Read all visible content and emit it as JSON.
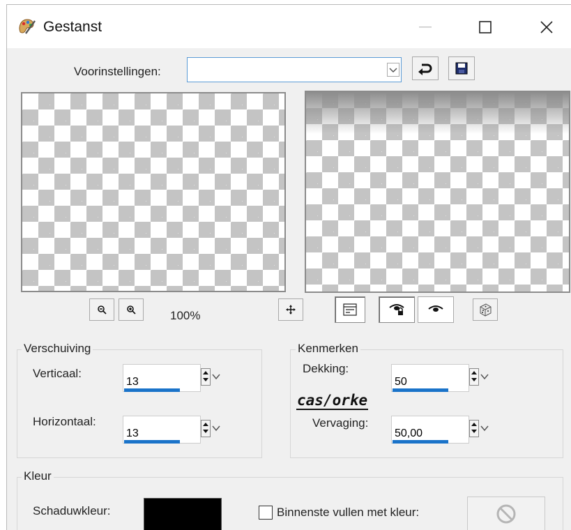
{
  "window": {
    "title": "Gestanst"
  },
  "presets": {
    "label": "Voorinstellingen:",
    "value": ""
  },
  "zoom": {
    "level": "100%"
  },
  "offset": {
    "title": "Verschuiving",
    "vertical_label": "Verticaal:",
    "vertical_value": "13",
    "horizontal_label": "Horizontaal:",
    "horizontal_value": "13"
  },
  "properties": {
    "title": "Kenmerken",
    "opacity_label": "Dekking:",
    "opacity_value": "50",
    "blur_label": "Vervaging:",
    "blur_value": "50,00"
  },
  "color": {
    "title": "Kleur",
    "shadow_label": "Schaduwkleur:",
    "shadow_color": "#000000",
    "fill_inner_label": "Binnenste vullen met kleur:"
  },
  "accent": "#1a73c9",
  "watermark": "casorke"
}
